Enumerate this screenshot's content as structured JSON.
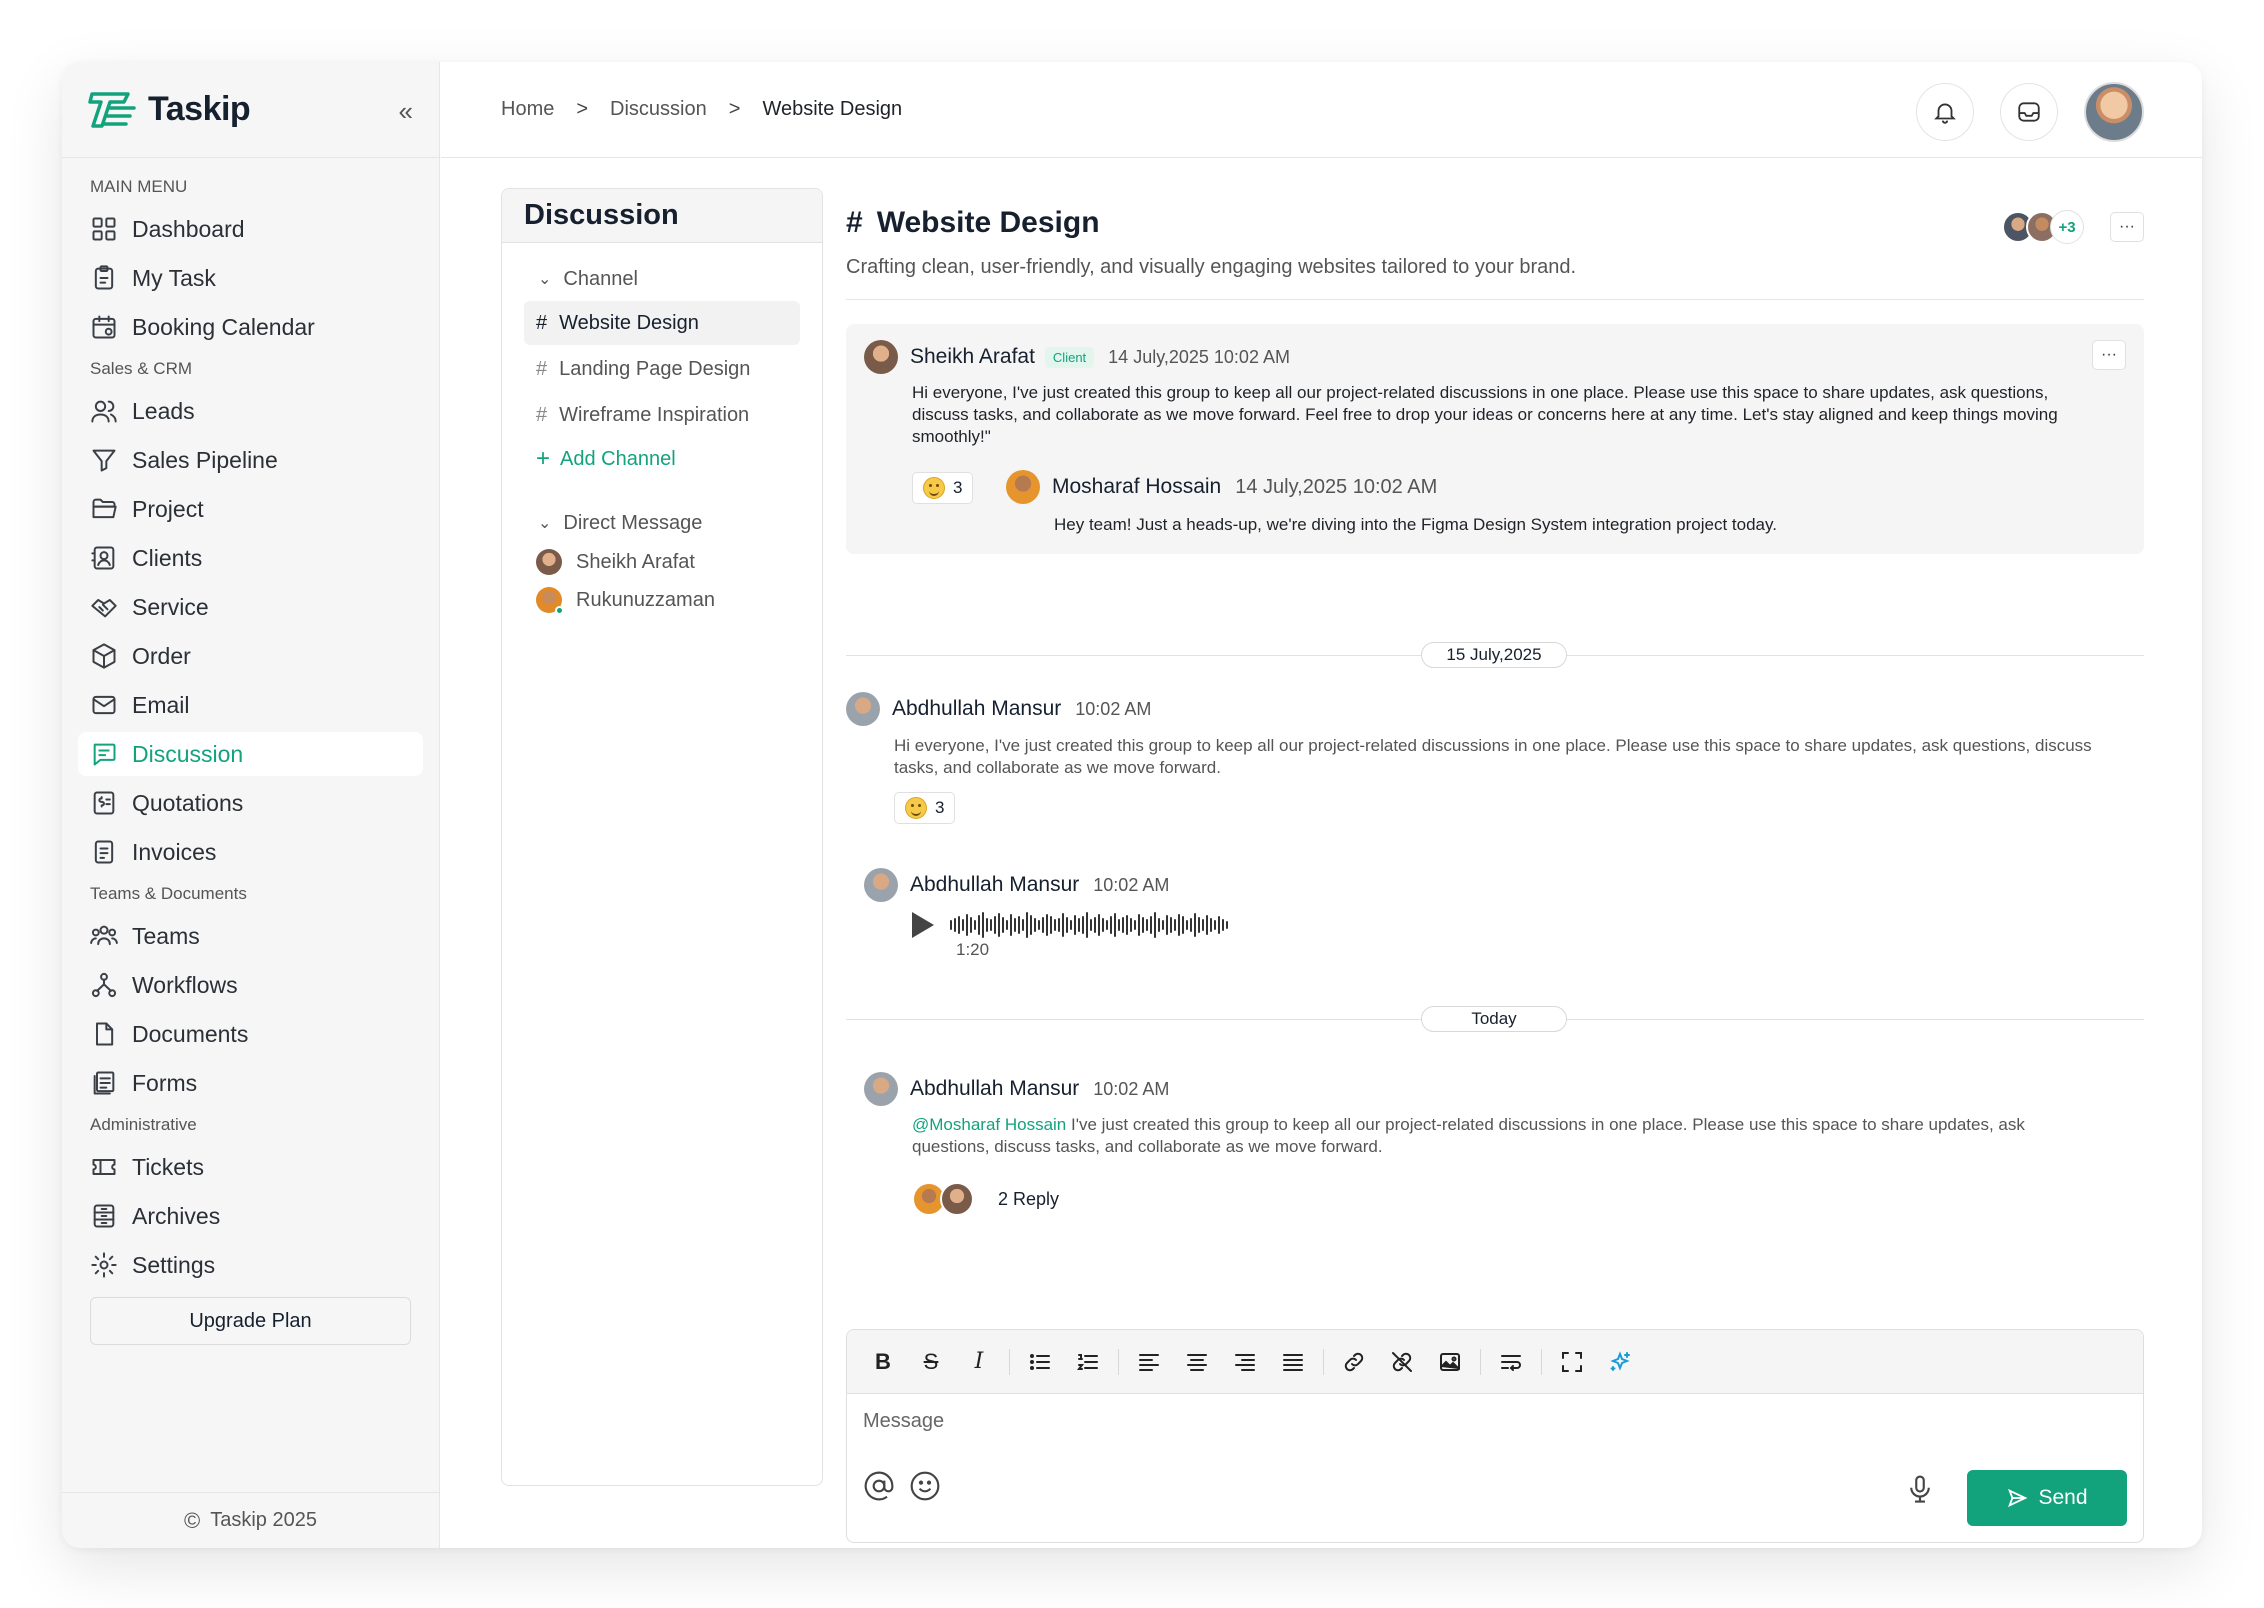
{
  "app": {
    "logo_text": "Taskip",
    "collapse_glyph": "«"
  },
  "sidebar": {
    "sections": [
      {
        "label": "MAIN MENU",
        "items": [
          {
            "label": "Dashboard",
            "icon": "dashboard-icon"
          },
          {
            "label": "My Task",
            "icon": "clipboard-icon"
          },
          {
            "label": "Booking Calendar",
            "icon": "calendar-icon"
          }
        ]
      },
      {
        "label": "Sales & CRM",
        "items": [
          {
            "label": "Leads",
            "icon": "users-icon"
          },
          {
            "label": "Sales Pipeline",
            "icon": "filter-icon"
          },
          {
            "label": "Project",
            "icon": "folder-icon"
          },
          {
            "label": "Clients",
            "icon": "contact-icon"
          },
          {
            "label": "Service",
            "icon": "handshake-icon"
          },
          {
            "label": "Order",
            "icon": "box-icon"
          },
          {
            "label": "Email",
            "icon": "mail-icon"
          },
          {
            "label": "Discussion",
            "icon": "chat-icon",
            "active": true
          },
          {
            "label": "Quotations",
            "icon": "quote-icon"
          },
          {
            "label": "Invoices",
            "icon": "invoice-icon"
          }
        ]
      },
      {
        "label": "Teams & Documents",
        "items": [
          {
            "label": "Teams",
            "icon": "team-icon"
          },
          {
            "label": "Workflows",
            "icon": "workflow-icon"
          },
          {
            "label": "Documents",
            "icon": "document-icon"
          },
          {
            "label": "Forms",
            "icon": "forms-icon"
          }
        ]
      },
      {
        "label": "Administrative",
        "items": [
          {
            "label": "Tickets",
            "icon": "ticket-icon"
          },
          {
            "label": "Archives",
            "icon": "archive-icon"
          },
          {
            "label": "Settings",
            "icon": "gear-icon"
          }
        ]
      }
    ],
    "upgrade_label": "Upgrade Plan",
    "copyright": "Taskip 2025",
    "copyright_glyph": "©"
  },
  "breadcrumb": {
    "items": [
      "Home",
      "Discussion",
      "Website Design"
    ],
    "separator": ">"
  },
  "channels_panel": {
    "title": "Discussion",
    "channel_group": "Channel",
    "channels": [
      {
        "name": "Website Design",
        "active": true
      },
      {
        "name": "Landing Page Design"
      },
      {
        "name": "Wireframe Inspiration"
      }
    ],
    "add_channel": "Add Channel",
    "dm_group": "Direct Message",
    "direct_messages": [
      {
        "name": "Sheikh Arafat"
      },
      {
        "name": "Rukunuzzaman"
      }
    ]
  },
  "channel": {
    "hash": "#",
    "title": "Website Design",
    "description": "Crafting clean, user-friendly, and visually engaging websites tailored to your brand.",
    "members_more": "+3",
    "more_glyph": "···"
  },
  "messages": {
    "m1": {
      "author": "Sheikh Arafat",
      "badge": "Client",
      "time": "14 July,2025 10:02 AM",
      "text": "Hi everyone, I've just created this group to keep all our project-related discussions in one place. Please use this space to share updates, ask questions, discuss tasks, and collaborate as we move forward. Feel free to drop your ideas or concerns here at any time. Let's stay aligned and keep things moving smoothly!\"",
      "reaction_count": "3"
    },
    "m1_reply": {
      "author": "Mosharaf Hossain",
      "time": "14 July,2025 10:02 AM",
      "text": "Hey team! Just a heads-up, we're diving into the Figma Design System integration project today."
    },
    "date1": "15 July,2025",
    "m2": {
      "author": "Abdhullah Mansur",
      "time": "10:02 AM",
      "text": "Hi everyone, I've just created this group to keep all our project-related discussions in one place. Please use this space to share updates, ask questions, discuss tasks, and collaborate as we move forward.",
      "reaction_count": "3"
    },
    "m3": {
      "author": "Abdhullah Mansur",
      "time": "10:02 AM",
      "audio_duration": "1:20"
    },
    "date2": "Today",
    "m4": {
      "author": "Abdhullah Mansur",
      "time": "10:02 AM",
      "mention": "@Mosharaf Hossain",
      "text": " I've just created this group to keep all our project-related discussions in one place. Please use this space to share updates, ask questions, discuss tasks, and collaborate as we move forward.",
      "reply_count": "2 Reply"
    }
  },
  "editor": {
    "placeholder": "Message",
    "send_label": "Send",
    "toolbar_glyphs": {
      "bold": "B",
      "strike": "S",
      "italic": "I"
    }
  },
  "colors": {
    "accent": "#12a37d",
    "sidebar_bg": "#f6f6f6",
    "card_bg": "#f5f5f5"
  }
}
